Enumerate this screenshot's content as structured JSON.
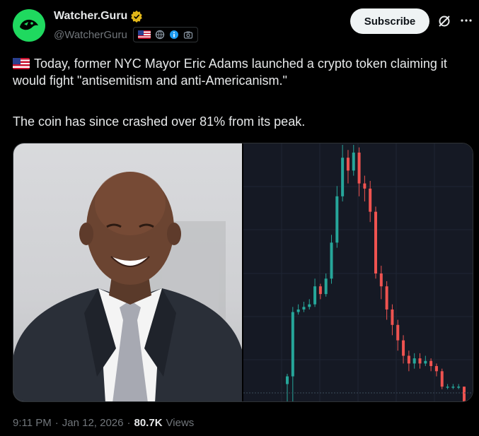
{
  "author": {
    "display_name": "Watcher.Guru",
    "handle": "@WatcherGuru",
    "avatar_color": "#1fd95f",
    "verified_color": "#e2b719"
  },
  "header": {
    "subscribe_label": "Subscribe",
    "badges": [
      "us-flag-icon",
      "globe-icon",
      "info-icon",
      "camera-icon"
    ]
  },
  "tweet": {
    "line1": "Today, former NYC Mayor Eric Adams launched a crypto token claiming it would fight \"antisemitism and anti-Americanism.\"",
    "line2": "The coin has since crashed over 81% from its peak."
  },
  "footer": {
    "time": "9:11 PM",
    "separator": "·",
    "date": "Jan 12, 2026",
    "views_count": "80.7K",
    "views_label": "Views"
  },
  "chart_data": {
    "type": "candlestick",
    "title": "",
    "candles": [
      {
        "o": 0.07,
        "c": 0.1,
        "h": 0.11,
        "l": 0.0
      },
      {
        "o": 0.1,
        "c": 0.35,
        "h": 0.37,
        "l": 0.0
      },
      {
        "o": 0.35,
        "c": 0.36,
        "h": 0.38,
        "l": 0.34
      },
      {
        "o": 0.36,
        "c": 0.37,
        "h": 0.39,
        "l": 0.35
      },
      {
        "o": 0.37,
        "c": 0.38,
        "h": 0.4,
        "l": 0.36
      },
      {
        "o": 0.38,
        "c": 0.45,
        "h": 0.48,
        "l": 0.37
      },
      {
        "o": 0.45,
        "c": 0.42,
        "h": 0.46,
        "l": 0.4
      },
      {
        "o": 0.42,
        "c": 0.48,
        "h": 0.5,
        "l": 0.41
      },
      {
        "o": 0.48,
        "c": 0.62,
        "h": 0.65,
        "l": 0.46
      },
      {
        "o": 0.62,
        "c": 0.8,
        "h": 0.84,
        "l": 0.6
      },
      {
        "o": 0.8,
        "c": 0.95,
        "h": 1.0,
        "l": 0.78
      },
      {
        "o": 0.95,
        "c": 0.9,
        "h": 0.98,
        "l": 0.85
      },
      {
        "o": 0.9,
        "c": 0.97,
        "h": 1.0,
        "l": 0.88
      },
      {
        "o": 0.97,
        "c": 0.85,
        "h": 0.99,
        "l": 0.8
      },
      {
        "o": 0.85,
        "c": 0.83,
        "h": 0.88,
        "l": 0.78
      },
      {
        "o": 0.83,
        "c": 0.74,
        "h": 0.86,
        "l": 0.7
      },
      {
        "o": 0.74,
        "c": 0.5,
        "h": 0.76,
        "l": 0.48
      },
      {
        "o": 0.5,
        "c": 0.45,
        "h": 0.53,
        "l": 0.4
      },
      {
        "o": 0.45,
        "c": 0.36,
        "h": 0.47,
        "l": 0.32
      },
      {
        "o": 0.36,
        "c": 0.3,
        "h": 0.38,
        "l": 0.26
      },
      {
        "o": 0.3,
        "c": 0.24,
        "h": 0.32,
        "l": 0.2
      },
      {
        "o": 0.24,
        "c": 0.18,
        "h": 0.26,
        "l": 0.15
      },
      {
        "o": 0.18,
        "c": 0.15,
        "h": 0.2,
        "l": 0.12
      },
      {
        "o": 0.15,
        "c": 0.17,
        "h": 0.19,
        "l": 0.13
      },
      {
        "o": 0.17,
        "c": 0.15,
        "h": 0.19,
        "l": 0.13
      },
      {
        "o": 0.15,
        "c": 0.16,
        "h": 0.18,
        "l": 0.14
      },
      {
        "o": 0.16,
        "c": 0.14,
        "h": 0.17,
        "l": 0.12
      },
      {
        "o": 0.14,
        "c": 0.12,
        "h": 0.15,
        "l": 0.1
      },
      {
        "o": 0.12,
        "c": 0.06,
        "h": 0.13,
        "l": 0.05
      },
      {
        "o": 0.06,
        "c": 0.06,
        "h": 0.07,
        "l": 0.05
      },
      {
        "o": 0.06,
        "c": 0.06,
        "h": 0.07,
        "l": 0.05
      },
      {
        "o": 0.06,
        "c": 0.06,
        "h": 0.07,
        "l": 0.05
      },
      {
        "o": 0.06,
        "c": 0.0,
        "h": 0.06,
        "l": 0.0
      }
    ],
    "up_color": "#26a69a",
    "down_color": "#ef5350",
    "grid": true
  }
}
